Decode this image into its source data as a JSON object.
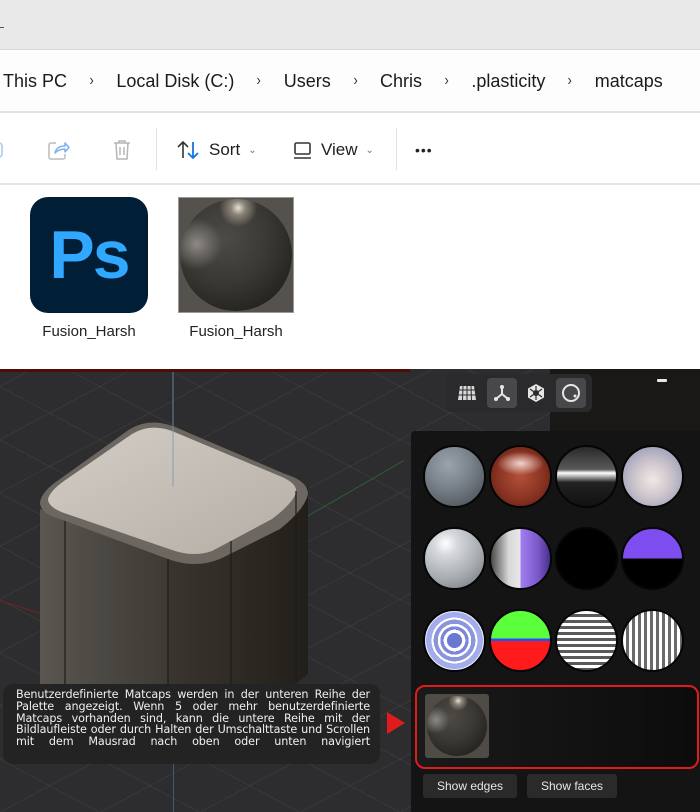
{
  "explorer": {
    "breadcrumb": [
      "This PC",
      "Local Disk (C:)",
      "Users",
      "Chris",
      ".plasticity",
      "matcaps"
    ],
    "breadcrumb_separator": "›",
    "toolbar": {
      "sort_label": "Sort",
      "view_label": "View",
      "more_label": "•••",
      "chevron": "⌄"
    },
    "files": [
      {
        "name": "Fusion_Harsh",
        "type": "Photoshop document",
        "icon_text": "Ps"
      },
      {
        "name": "Fusion_Harsh",
        "type": "image"
      }
    ],
    "colors": {
      "ps_bg": "#001e36",
      "ps_text": "#31a8ff",
      "sort_arrow_accent": "#1a73d9"
    }
  },
  "viewport": {
    "view_modes": [
      {
        "name": "wireframe",
        "active": false
      },
      {
        "name": "vertex",
        "active": true
      },
      {
        "name": "solid-hex",
        "active": false
      },
      {
        "name": "matcap",
        "active": true
      }
    ],
    "matcaps": [
      {
        "name": "grey-metal"
      },
      {
        "name": "red-gloss"
      },
      {
        "name": "chrome-horizon"
      },
      {
        "name": "pearl"
      },
      {
        "name": "light-grey-gloss"
      },
      {
        "name": "grey-purple-split"
      },
      {
        "name": "black"
      },
      {
        "name": "purple-black-split"
      },
      {
        "name": "blue-rings"
      },
      {
        "name": "green-red-split"
      },
      {
        "name": "horizontal-stripes"
      },
      {
        "name": "vertical-stripes"
      }
    ],
    "custom_matcaps": [
      {
        "name": "Fusion_Harsh"
      }
    ],
    "buttons": {
      "show_edges": "Show edges",
      "show_faces": "Show faces"
    },
    "highlight_color": "#e01b1b",
    "tooltip": "Benutzerdefinierte Matcaps werden in der unteren Reihe der Palette angezeigt. Wenn 5 oder mehr benutzerdefinierte Matcaps vorhanden sind, kann die untere Reihe mit der Bildlaufleiste oder durch Halten der Umschalttaste und Scrollen mit dem Mausrad nach oben oder unten navigiert"
  }
}
